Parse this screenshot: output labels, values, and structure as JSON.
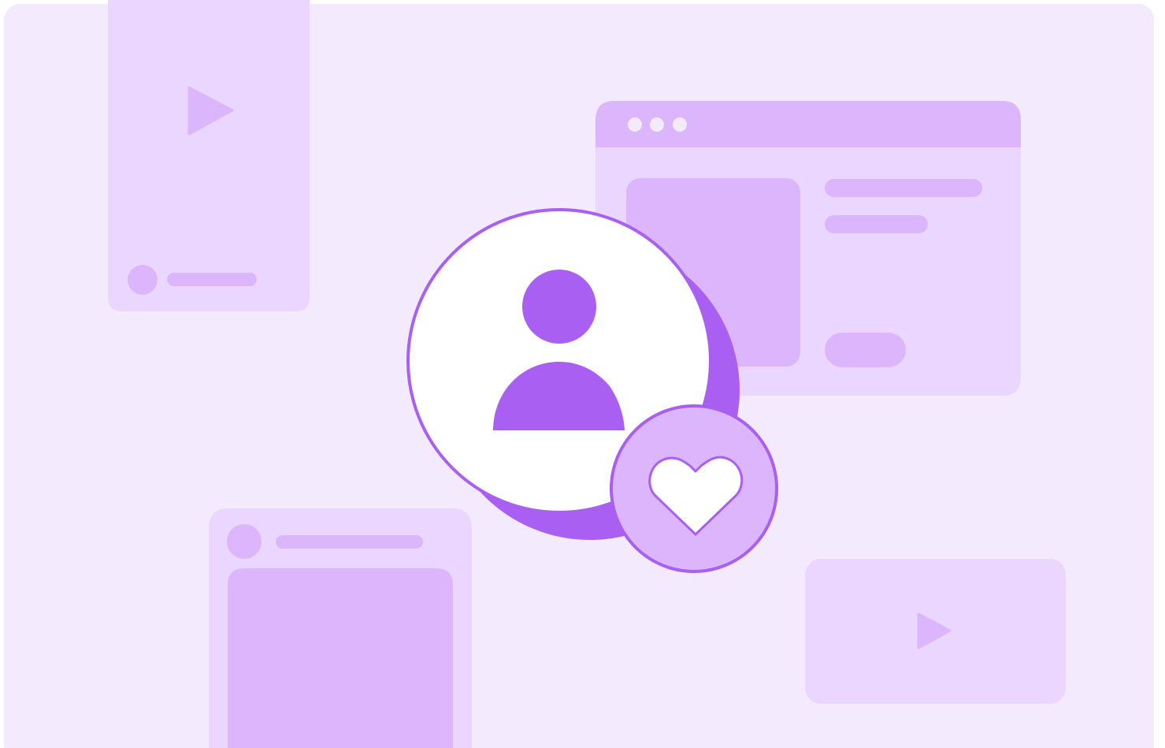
{
  "illustration": {
    "cards": [
      {
        "kind": "vertical-video",
        "icon": "play-icon"
      },
      {
        "kind": "browser-window",
        "icon": "window-dots-icon"
      },
      {
        "kind": "social-post",
        "icon": "avatar-icon"
      },
      {
        "kind": "horizontal-video",
        "icon": "play-icon"
      }
    ],
    "profile": {
      "icon": "user-icon"
    },
    "reaction": {
      "icon": "heart-icon"
    }
  },
  "colors": {
    "background_panel": "#F4EAFD",
    "card_light": "#EAD6FE",
    "card_medium": "#DCB6FD",
    "accent": "#A95FF1",
    "white": "#FFFFFF"
  }
}
